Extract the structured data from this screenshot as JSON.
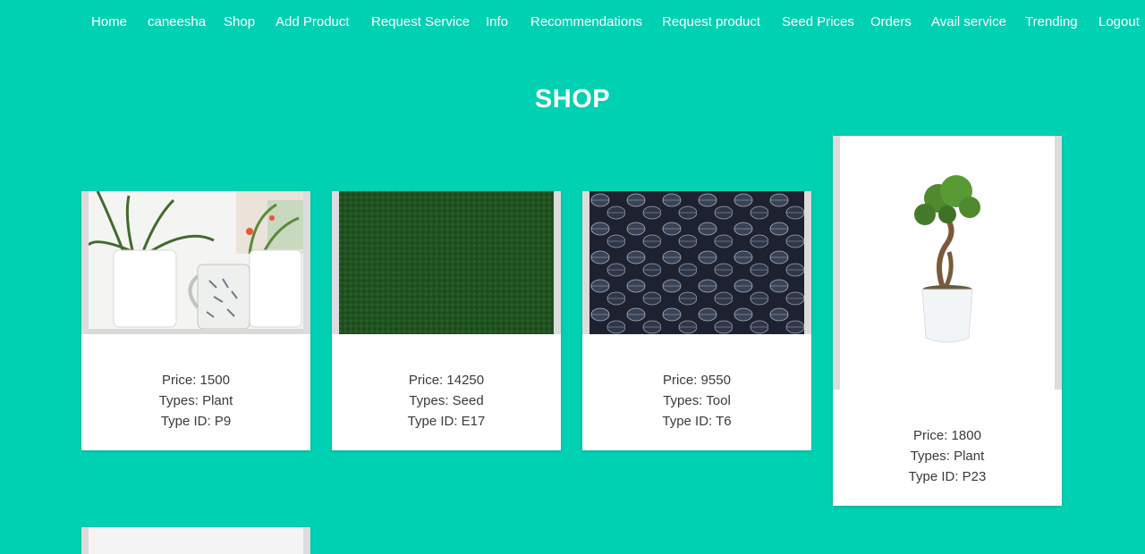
{
  "nav": {
    "items": [
      "Home",
      "caneesha",
      "Shop",
      "Add Product",
      "Request Service",
      "Info",
      "Recommendations",
      "Request product",
      "Seed Prices",
      "Orders",
      "Avail service",
      "Trending",
      "Logout"
    ]
  },
  "page": {
    "title": "SHOP"
  },
  "products": [
    {
      "image_icon": "potted-plants-photo",
      "price_label": "Price: 1500",
      "type_label": "Types: Plant",
      "type_id_label": "Type ID: P9"
    },
    {
      "image_icon": "grass-texture-photo",
      "price_label": "Price: 14250",
      "type_label": "Types: Seed",
      "type_id_label": "Type ID: E17"
    },
    {
      "image_icon": "dark-leaves-photo",
      "price_label": "Price: 9550",
      "type_label": "Types: Tool",
      "type_id_label": "Type ID: T6"
    },
    {
      "image_icon": "bonsai-tree-photo",
      "price_label": "Price: 1800",
      "type_label": "Types: Plant",
      "type_id_label": "Type ID: P23"
    }
  ],
  "colors": {
    "background": "#00d1b2",
    "card": "#ffffff",
    "text": "#3a3a3a"
  }
}
